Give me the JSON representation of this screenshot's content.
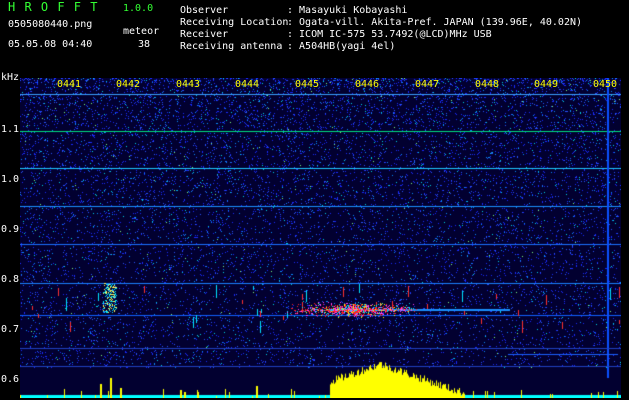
{
  "header": {
    "app_title": "H R O F F T",
    "version": "1.0.0",
    "filename": "0505080440.png",
    "datetime": "05.05.08 04:40",
    "meteor_label": "meteor",
    "meteor_count": "38",
    "observer_label": "Observer",
    "observer_value": ": Masayuki Kobayashi",
    "location_label": "Receiving Location",
    "location_value": ": Ogata-vill. Akita-Pref. JAPAN (139.96E, 40.02N)",
    "receiver_label": "Receiver",
    "receiver_value": ": ICOM IC-575 53.7492(@LCD)MHz USB",
    "antenna_label": "Receiving antenna",
    "antenna_value": ": A504HB(yagi 4el)"
  },
  "y_axis": {
    "unit": "kHz",
    "ticks": [
      "1.1",
      "1.0",
      "0.9",
      "0.8",
      "0.7",
      "0.6"
    ]
  },
  "time_ticks": [
    "0441",
    "0442",
    "0443",
    "0444",
    "0445",
    "0446",
    "0447",
    "0448",
    "0449",
    "0450"
  ],
  "colors": {
    "background": "#000000",
    "header_green": "#33ff33",
    "text_white": "#ffffff",
    "time_yellow": "#ffff00",
    "spectrum_base": "#020030",
    "noise_blue": "#1a3cff",
    "trace_cyan": "#00e5ff",
    "burst_red": "#ff2020",
    "bar_yellow": "#ffff00",
    "bar_cyan": "#00ffff"
  }
}
